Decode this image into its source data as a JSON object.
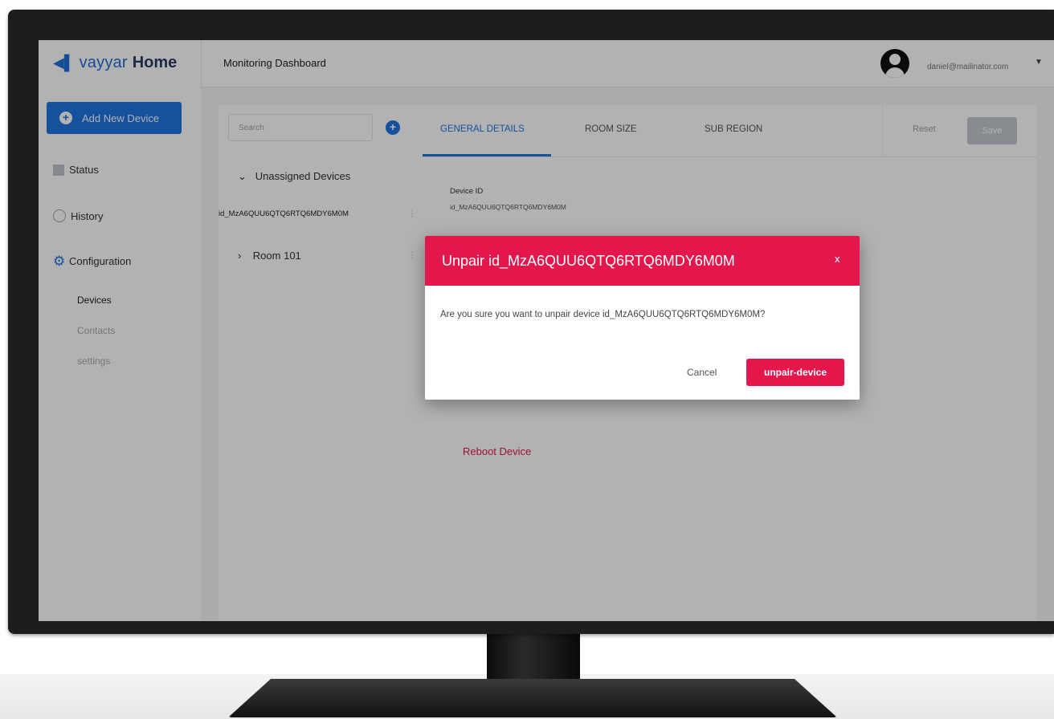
{
  "app": {
    "logo_brand": "vayyar",
    "logo_suffix": "Home",
    "page_title": "Monitoring Dashboard",
    "user_email": "daniel@mailinator.com"
  },
  "sidebar": {
    "add_button": "Add New Device",
    "items": [
      {
        "label": "Status",
        "icon": "status-icon"
      },
      {
        "label": "History",
        "icon": "history-icon"
      },
      {
        "label": "Configuration",
        "icon": "gear-icon"
      }
    ],
    "subitems": [
      "Devices",
      "Contacts",
      "settings"
    ]
  },
  "device_list": {
    "search_placeholder": "Search",
    "unassigned_group": "Unassigned Devices",
    "device_id": "id_MzA6QUU6QTQ6RTQ6MDY6M0M",
    "room_group": "Room 101"
  },
  "details": {
    "tabs": [
      "GENERAL DETAILS",
      "ROOM SIZE",
      "SUB REGION"
    ],
    "reset_label": "Reset",
    "save_label": "Save",
    "device_id_label": "Device ID",
    "device_id_value": "id_MzA6QUU6QTQ6RTQ6MDY6M0M",
    "reboot_label": "Reboot Device"
  },
  "modal": {
    "title": "Unpair id_MzA6QUU6QTQ6RTQ6MDY6M0M",
    "close_label": "x",
    "message": "Are you sure you want to unpair device id_MzA6QUU6QTQ6RTQ6MDY6M0M?",
    "cancel_label": "Cancel",
    "confirm_label": "unpair-device"
  },
  "colors": {
    "accent_blue": "#1f74e0",
    "danger_red": "#e3174c"
  }
}
